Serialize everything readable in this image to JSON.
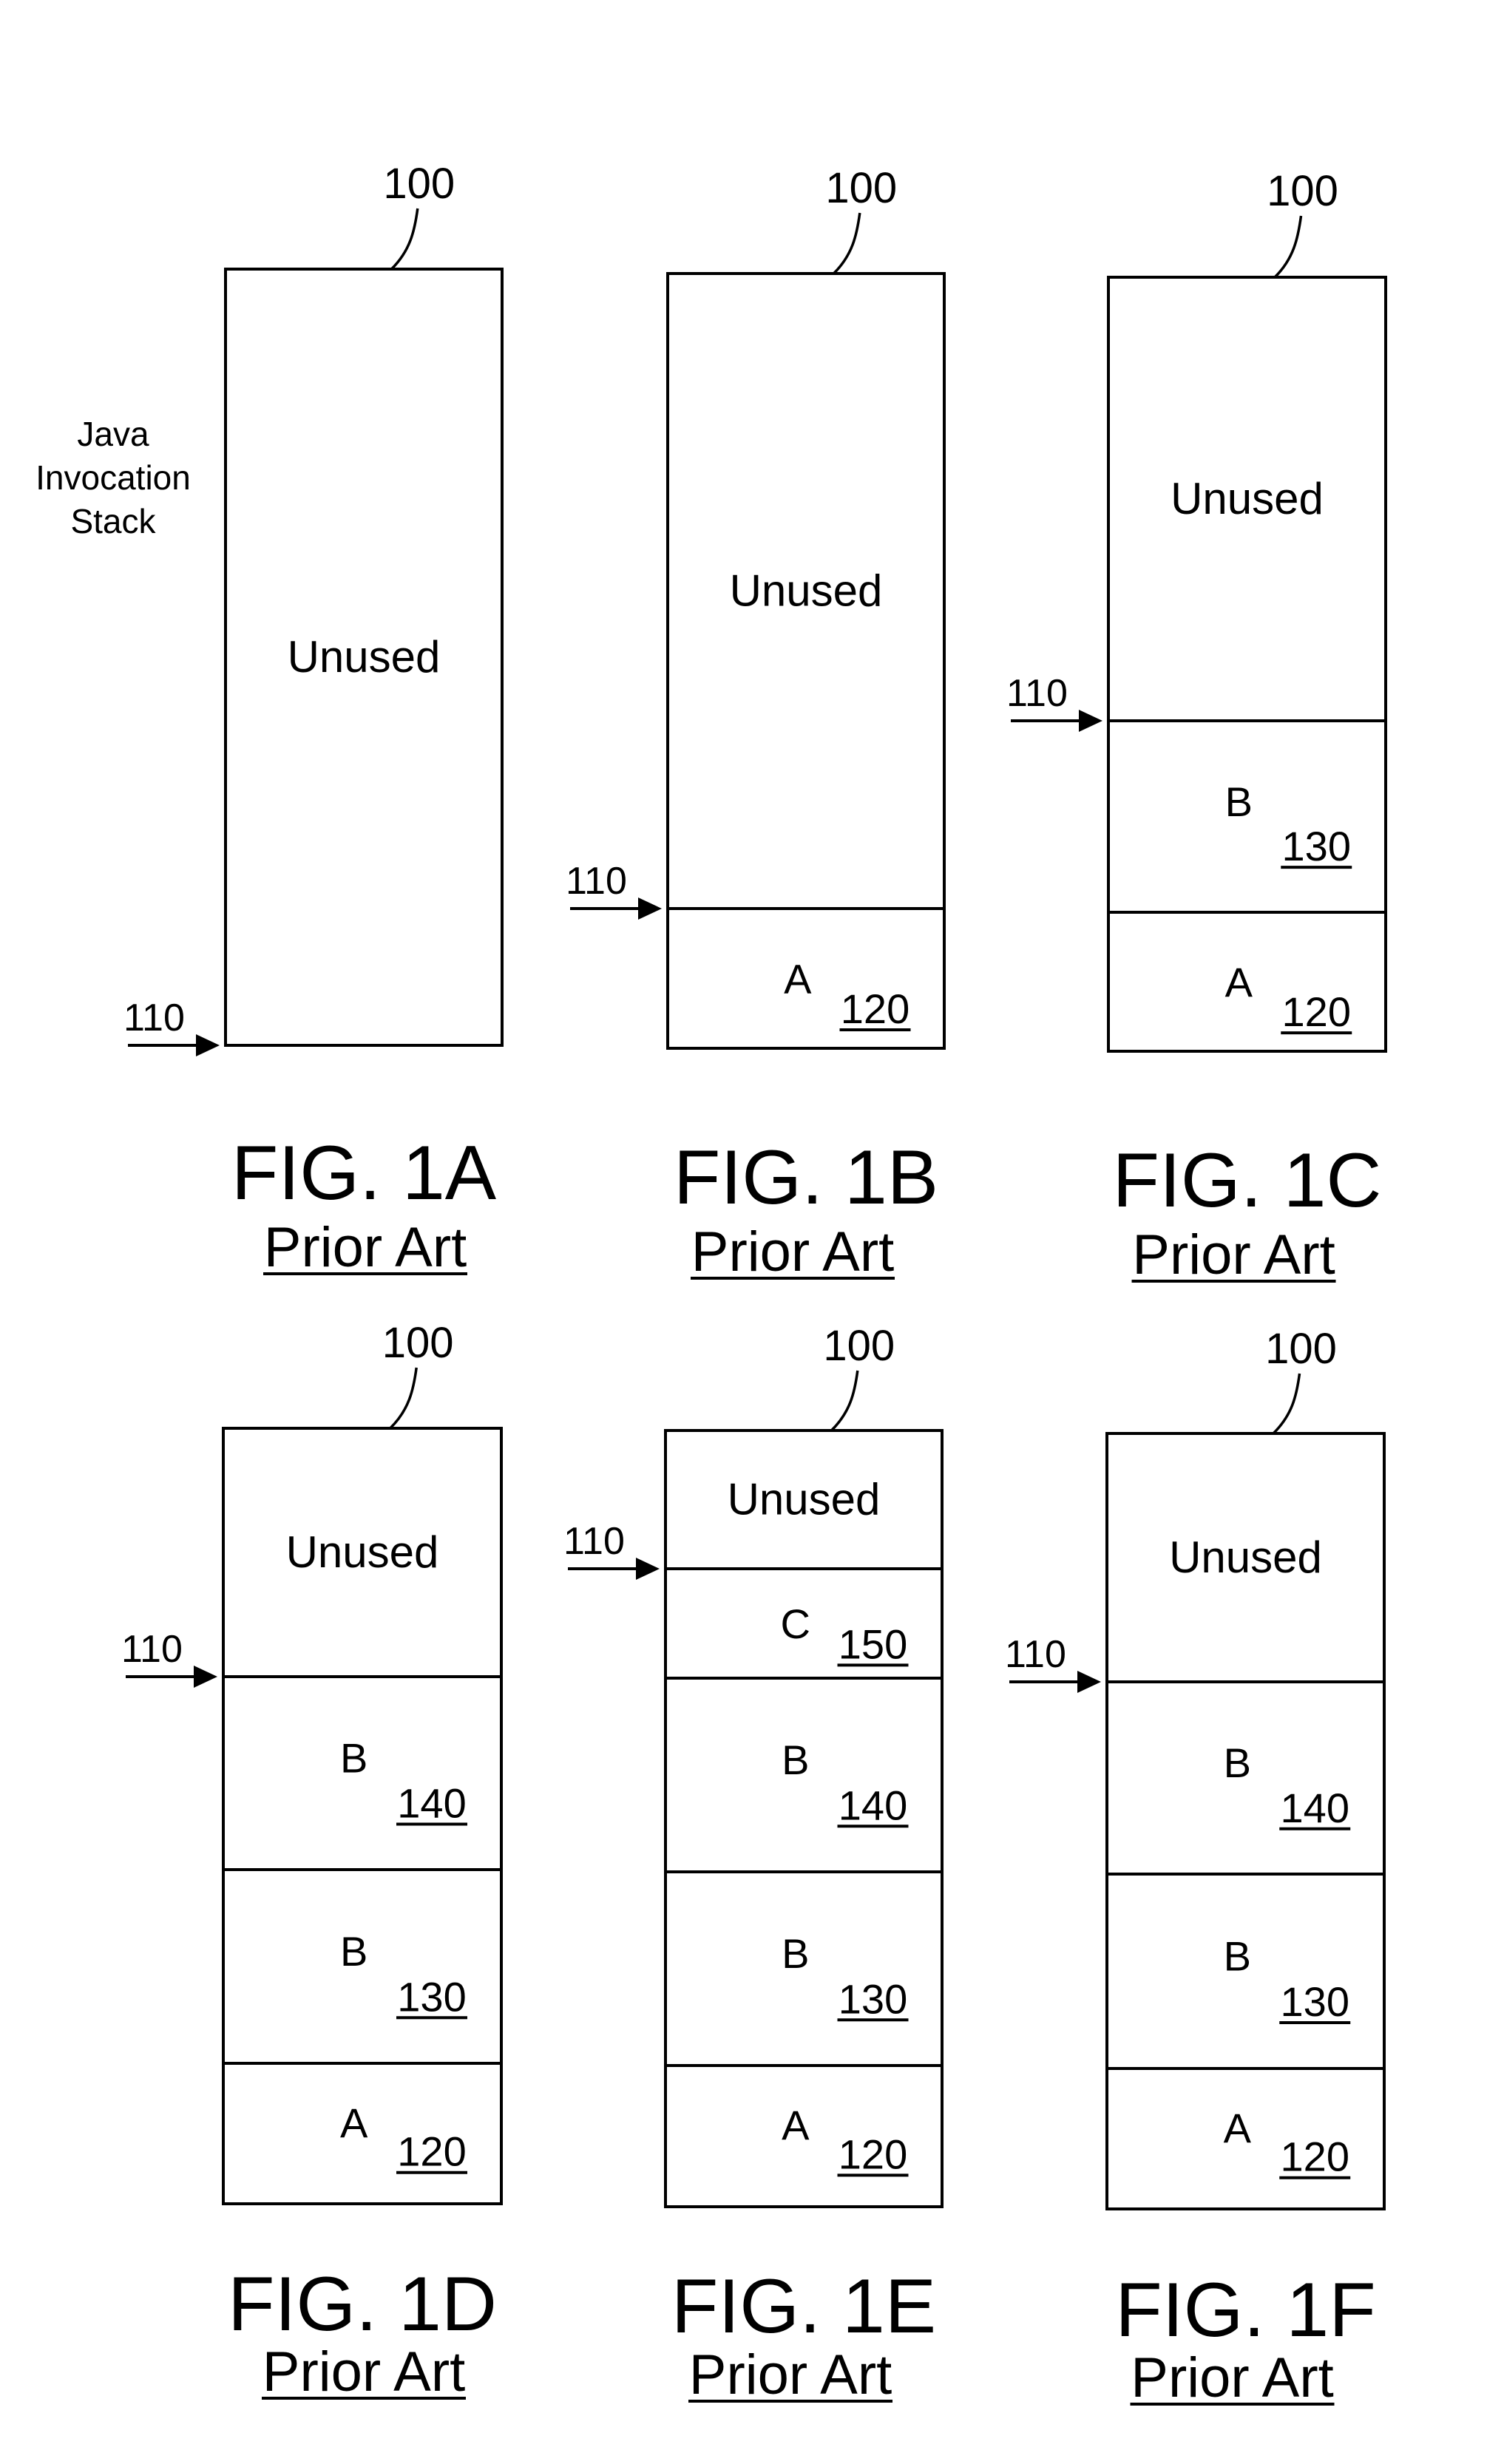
{
  "side_label": [
    "Java",
    "Invocation",
    "Stack"
  ],
  "stack_ref": "100",
  "pointer_ref": "110",
  "unused_label": "Unused",
  "prior_art_label": "Prior Art",
  "figures": [
    {
      "id": "1A",
      "title": "FIG. 1A",
      "pointer_below_section": 0,
      "sections_top_to_bottom": [
        {
          "label": "Unused",
          "ref": ""
        }
      ]
    },
    {
      "id": "1B",
      "title": "FIG. 1B",
      "pointer_below_section": 0,
      "sections_top_to_bottom": [
        {
          "label": "Unused",
          "ref": ""
        },
        {
          "label": "A",
          "ref": "120"
        }
      ]
    },
    {
      "id": "1C",
      "title": "FIG. 1C",
      "pointer_below_section": 0,
      "sections_top_to_bottom": [
        {
          "label": "Unused",
          "ref": ""
        },
        {
          "label": "B",
          "ref": "130"
        },
        {
          "label": "A",
          "ref": "120"
        }
      ]
    },
    {
      "id": "1D",
      "title": "FIG. 1D",
      "pointer_below_section": 0,
      "sections_top_to_bottom": [
        {
          "label": "Unused",
          "ref": ""
        },
        {
          "label": "B",
          "ref": "140"
        },
        {
          "label": "B",
          "ref": "130"
        },
        {
          "label": "A",
          "ref": "120"
        }
      ]
    },
    {
      "id": "1E",
      "title": "FIG. 1E",
      "pointer_below_section": 0,
      "sections_top_to_bottom": [
        {
          "label": "Unused",
          "ref": ""
        },
        {
          "label": "C",
          "ref": "150"
        },
        {
          "label": "B",
          "ref": "140"
        },
        {
          "label": "B",
          "ref": "130"
        },
        {
          "label": "A",
          "ref": "120"
        }
      ]
    },
    {
      "id": "1F",
      "title": "FIG. 1F",
      "pointer_below_section": 0,
      "sections_top_to_bottom": [
        {
          "label": "Unused",
          "ref": ""
        },
        {
          "label": "B",
          "ref": "140"
        },
        {
          "label": "B",
          "ref": "130"
        },
        {
          "label": "A",
          "ref": "120"
        }
      ]
    }
  ]
}
